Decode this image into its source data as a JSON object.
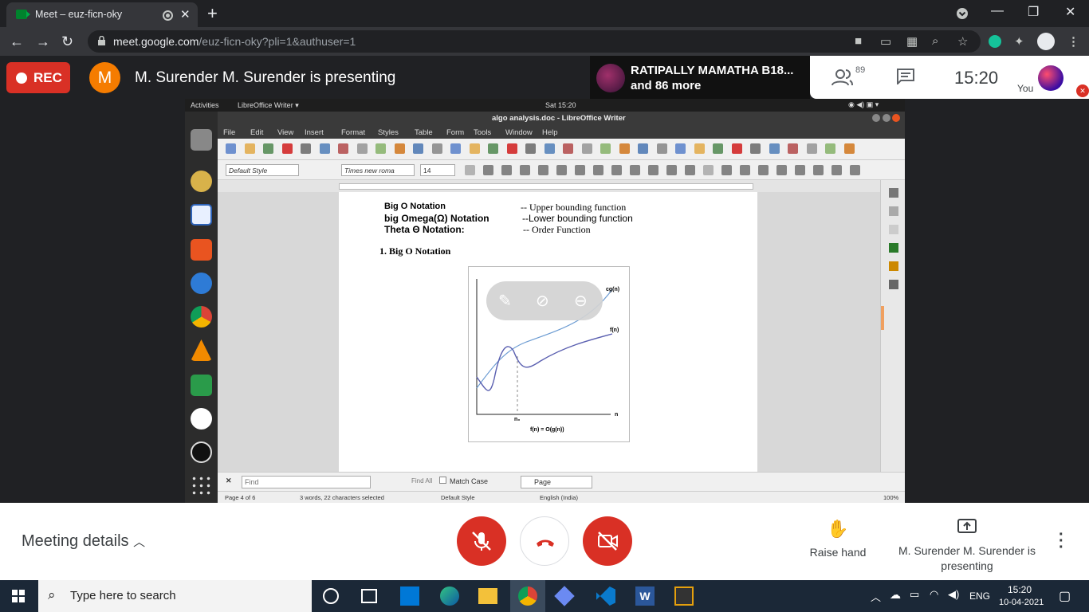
{
  "browser": {
    "tab_title": "Meet – euz-ficn-oky",
    "new_tab": "+",
    "url_domain": "meet.google.com",
    "url_path": "/euz-ficn-oky?pli=1&authuser=1",
    "window_controls": {
      "minimize": "—",
      "restore": "❐",
      "close": "✕"
    }
  },
  "meet_header": {
    "rec_label": "REC",
    "presenter_initial": "M",
    "presenter_text": "M. Surender M. Surender is presenting",
    "participant_name": "RATIPALLY MAMATHA B18...",
    "participant_more": "and 86 more",
    "people_count": "89",
    "time": "15:20",
    "you_label": "You"
  },
  "shared_screen": {
    "gnome": {
      "activities": "Activities",
      "app": "LibreOffice Writer ▾",
      "clock": "Sat 15:20"
    },
    "window_title": "algo analysis.doc - LibreOffice Writer",
    "menu": [
      "File",
      "Edit",
      "View",
      "Insert",
      "Format",
      "Styles",
      "Table",
      "Form",
      "Tools",
      "Window",
      "Help"
    ],
    "para_style": "Default Style",
    "font_name": "Times new roma",
    "font_size": "14",
    "doc": {
      "l1a": "Big O Notation",
      "l1b": "-- Upper bounding function",
      "l2a": "big Omega(Ω) Notation",
      "l2b": "--Lower bounding function",
      "l3a": "Theta Θ Notation:",
      "l3b": "-- Order Function",
      "heading": "1. Big O Notation",
      "fig_cg": "cg(n)",
      "fig_f": "f(n)",
      "fig_n": "n",
      "fig_n0": "n₀",
      "fig_caption": "f(n) = O(g(n))"
    },
    "find": {
      "placeholder": "Find",
      "find_all": "Find All",
      "match_case": "Match Case",
      "page": "Page"
    },
    "status": {
      "page": "Page 4 of 6",
      "words": "3 words, 22 characters selected",
      "style": "Default Style",
      "lang": "English (India)",
      "zoom": "100%"
    }
  },
  "meet_bottom": {
    "meeting_details": "Meeting details",
    "raise_hand": "Raise hand",
    "presenting": "M. Surender M. Surender is presenting"
  },
  "taskbar": {
    "search": "Type here to search",
    "lang": "ENG",
    "time": "15:20",
    "date": "10-04-2021"
  },
  "colors": {
    "red": "#d93025",
    "meet_dark": "#202124",
    "orange": "#f57c00"
  }
}
